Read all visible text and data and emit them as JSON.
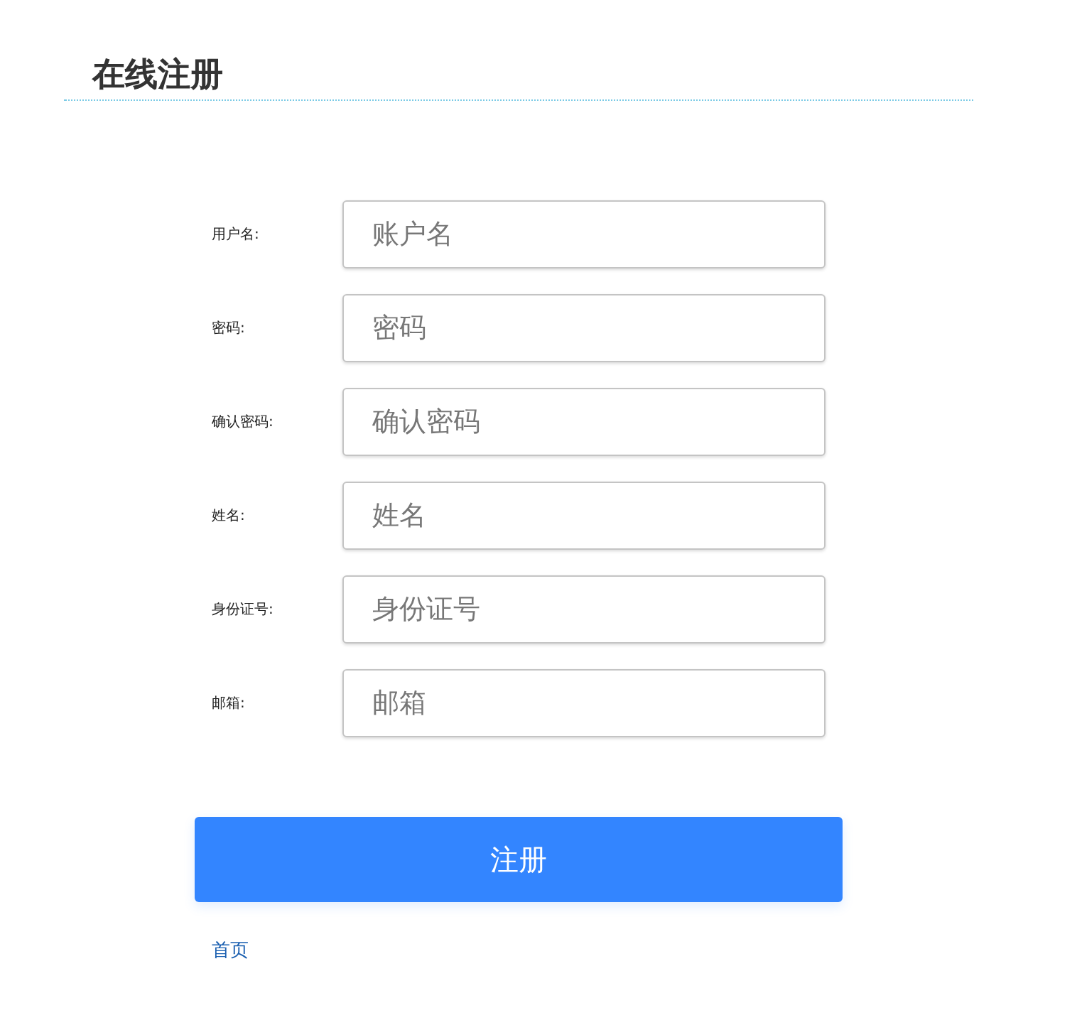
{
  "title": "在线注册",
  "fields": [
    {
      "label": "用户名:",
      "placeholder": "账户名"
    },
    {
      "label": "密码:",
      "placeholder": "密码"
    },
    {
      "label": "确认密码:",
      "placeholder": "确认密码"
    },
    {
      "label": "姓名:",
      "placeholder": "姓名"
    },
    {
      "label": "身份证号:",
      "placeholder": "身份证号"
    },
    {
      "label": "邮箱:",
      "placeholder": "邮箱"
    }
  ],
  "submit_button": "注册",
  "home_link": "首页"
}
